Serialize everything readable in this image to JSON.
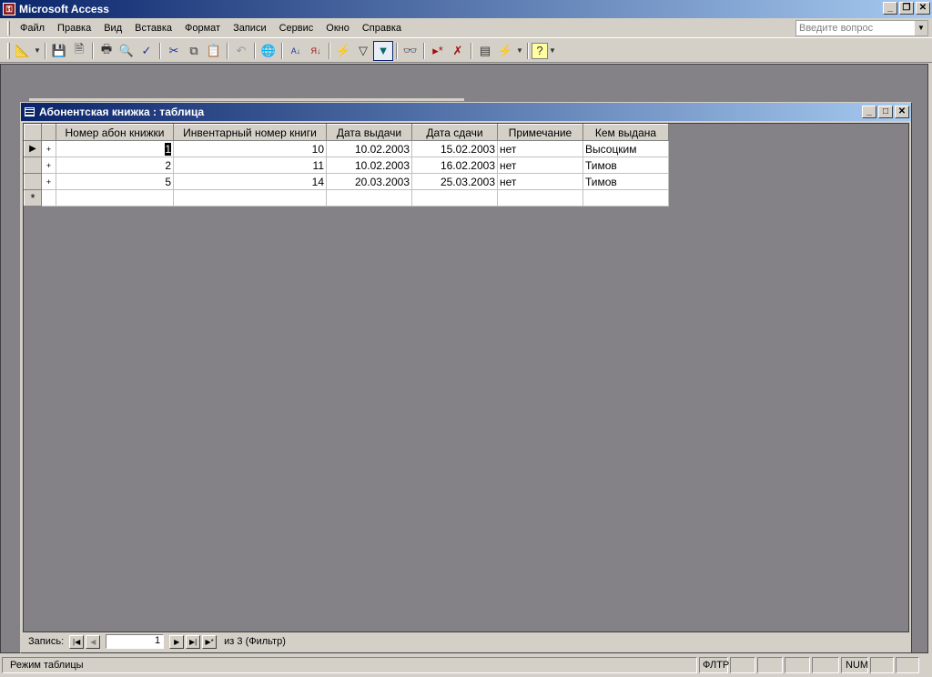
{
  "app": {
    "title": "Microsoft Access"
  },
  "menu": [
    "Файл",
    "Правка",
    "Вид",
    "Вставка",
    "Формат",
    "Записи",
    "Сервис",
    "Окно",
    "Справка"
  ],
  "ask": {
    "placeholder": "Введите вопрос"
  },
  "toolbar": [
    "design-view",
    "save",
    "file-search",
    "print",
    "print-preview",
    "spelling",
    "cut",
    "copy",
    "paste",
    "undo",
    "hyperlink",
    "sort-ascending",
    "sort-descending",
    "filter-by-selection",
    "filter-by-form",
    "apply-filter",
    "find",
    "new-record",
    "delete-record",
    "database-window",
    "new-object",
    "help"
  ],
  "child": {
    "title": "Абонентская книжка : таблица"
  },
  "table": {
    "columns": [
      "Номер абон книжки",
      "Инвентарный номер книги",
      "Дата выдачи",
      "Дата сдачи",
      "Примечание",
      "Кем выдана"
    ],
    "rows": [
      [
        "1",
        "10",
        "10.02.2003",
        "15.02.2003",
        "нет",
        "Высоцким"
      ],
      [
        "2",
        "11",
        "10.02.2003",
        "16.02.2003",
        "нет",
        "Тимов"
      ],
      [
        "5",
        "14",
        "20.03.2003",
        "25.03.2003",
        "нет",
        "Тимов"
      ]
    ]
  },
  "nav": {
    "label": "Запись:",
    "current": "1",
    "total": "из  3 (Фильтр)"
  },
  "status": {
    "mode": "Режим таблицы",
    "filter": "ФЛТР",
    "num": "NUM"
  }
}
